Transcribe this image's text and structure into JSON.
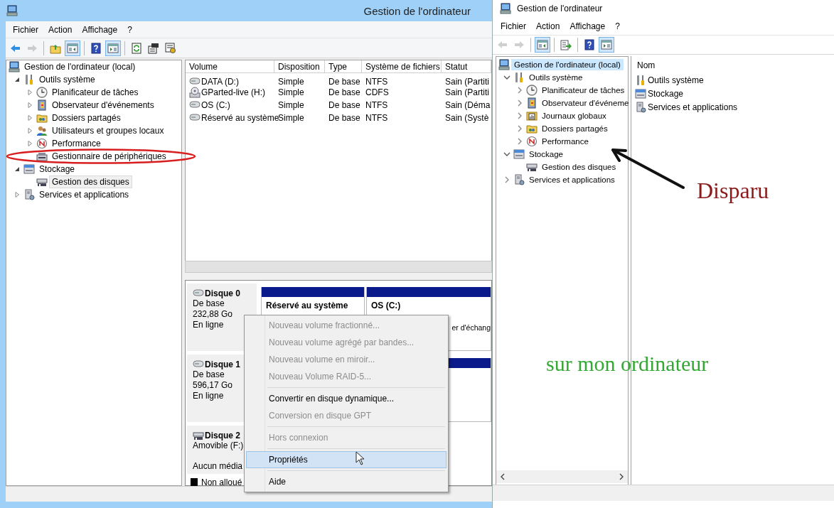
{
  "left_window": {
    "title": "Gestion de l'ordinateur",
    "menu": [
      "Fichier",
      "Action",
      "Affichage",
      "?"
    ],
    "toolbar": [
      {
        "kind": "button",
        "disabled": false,
        "pressed": false
      },
      {
        "kind": "button",
        "disabled": true,
        "pressed": false
      },
      {
        "kind": "separator"
      },
      {
        "kind": "button",
        "disabled": false,
        "pressed": false
      },
      {
        "kind": "button",
        "disabled": false,
        "pressed": true
      },
      {
        "kind": "separator"
      },
      {
        "kind": "button",
        "disabled": false,
        "pressed": false
      },
      {
        "kind": "button",
        "disabled": false,
        "pressed": true
      },
      {
        "kind": "separator"
      },
      {
        "kind": "button",
        "disabled": false,
        "pressed": false
      },
      {
        "kind": "button",
        "disabled": false,
        "pressed": false
      },
      {
        "kind": "button",
        "disabled": false,
        "pressed": false
      }
    ],
    "tree": [
      {
        "label": "Gestion de l'ordinateur (local)",
        "selected": false,
        "children": [
          {
            "label": "Outils système",
            "expanded": true,
            "selected": false,
            "children": [
              {
                "label": "Planificateur de tâches",
                "expanded": false,
                "selected": false
              },
              {
                "label": "Observateur d'événements",
                "expanded": false,
                "selected": false
              },
              {
                "label": "Dossiers partagés",
                "expanded": false,
                "selected": false
              },
              {
                "label": "Utilisateurs et groupes locaux",
                "expanded": false,
                "selected": false
              },
              {
                "label": "Performance",
                "expanded": false,
                "selected": false
              },
              {
                "label": "Gestionnaire de périphériques",
                "selected": false
              }
            ]
          },
          {
            "label": "Stockage",
            "expanded": true,
            "selected": false,
            "children": [
              {
                "label": "Gestion des disques",
                "selected": true
              }
            ]
          },
          {
            "label": "Services et applications",
            "expanded": false,
            "selected": false
          }
        ]
      }
    ],
    "volumes": {
      "columns": [
        "Volume",
        "Disposition",
        "Type",
        "Système de fichiers",
        "Statut"
      ],
      "rows": [
        [
          "DATA (D:)",
          "Simple",
          "De base",
          "NTFS",
          "Sain (Partiti"
        ],
        [
          "GParted-live (H:)",
          "Simple",
          "De base",
          "CDFS",
          "Sain (Partiti"
        ],
        [
          "OS (C:)",
          "Simple",
          "De base",
          "NTFS",
          "Sain (Déma"
        ],
        [
          "Réservé au système",
          "Simple",
          "De base",
          "NTFS",
          "Sain (Systè"
        ]
      ]
    },
    "disks": [
      {
        "name": "Disque 0",
        "lines": [
          "De base",
          "232,88 Go",
          "En ligne"
        ],
        "partitions": [
          {
            "kind": "primary",
            "name": "Réservé au système"
          },
          {
            "kind": "primary",
            "name": "OS  (C:)",
            "note": "er d'échang"
          }
        ]
      },
      {
        "name": "Disque 1",
        "lines": [
          "De base",
          "596,17 Go",
          "En ligne"
        ],
        "partitions": [
          {
            "kind": "primary"
          }
        ]
      },
      {
        "name": "Disque 2",
        "lines": [
          "Amovible (F:)"
        ],
        "media": "Aucun média"
      }
    ],
    "legend": [
      {
        "kind": "unallocated",
        "label": "Non alloué"
      }
    ],
    "context_menu": [
      {
        "kind": "item",
        "label": "Nouveau volume fractionné...",
        "disabled": true,
        "selected": false
      },
      {
        "kind": "item",
        "label": "Nouveau volume agrégé par bandes...",
        "disabled": true,
        "selected": false
      },
      {
        "kind": "item",
        "label": "Nouveau volume en miroir...",
        "disabled": true,
        "selected": false
      },
      {
        "kind": "item",
        "label": "Nouveau Volume RAID-5...",
        "disabled": true,
        "selected": false
      },
      {
        "kind": "separator"
      },
      {
        "kind": "item",
        "label": "Convertir en disque dynamique...",
        "disabled": false,
        "selected": false
      },
      {
        "kind": "item",
        "label": "Conversion en disque GPT",
        "disabled": true,
        "selected": false
      },
      {
        "kind": "separator"
      },
      {
        "kind": "item",
        "label": "Hors connexion",
        "disabled": true,
        "selected": false
      },
      {
        "kind": "separator"
      },
      {
        "kind": "item",
        "label": "Propriétés",
        "disabled": false,
        "selected": true
      },
      {
        "kind": "separator"
      },
      {
        "kind": "item",
        "label": "Aide",
        "disabled": false,
        "selected": false
      }
    ]
  },
  "right_window": {
    "title": "Gestion de l'ordinateur",
    "menu": [
      "Fichier",
      "Action",
      "Affichage",
      "?"
    ],
    "toolbar": [
      {
        "kind": "button",
        "disabled": true,
        "pressed": false
      },
      {
        "kind": "button",
        "disabled": true,
        "pressed": false
      },
      {
        "kind": "separator"
      },
      {
        "kind": "button",
        "disabled": false,
        "pressed": true
      },
      {
        "kind": "separator"
      },
      {
        "kind": "button",
        "disabled": false,
        "pressed": false
      },
      {
        "kind": "separator"
      },
      {
        "kind": "button",
        "disabled": false,
        "pressed": false
      },
      {
        "kind": "button",
        "disabled": false,
        "pressed": true
      }
    ],
    "tree": [
      {
        "label": "Gestion de l'ordinateur (local)",
        "selected": true,
        "children": [
          {
            "label": "Outils système",
            "expanded": true,
            "selected": false,
            "children": [
              {
                "label": "Planificateur de tâches",
                "expanded": false,
                "selected": false
              },
              {
                "label": "Observateur d'événeme",
                "expanded": false,
                "selected": false
              },
              {
                "label": "Journaux globaux",
                "expanded": false,
                "selected": false
              },
              {
                "label": "Dossiers partagés",
                "expanded": false,
                "selected": false
              },
              {
                "label": "Performance",
                "expanded": false,
                "selected": false
              }
            ]
          },
          {
            "label": "Stockage",
            "expanded": true,
            "selected": false,
            "children": [
              {
                "label": "Gestion des disques",
                "selected": false
              }
            ]
          },
          {
            "label": "Services et applications",
            "expanded": false,
            "selected": false
          }
        ]
      }
    ],
    "list": {
      "header": "Nom",
      "items": [
        "Outils système",
        "Stockage",
        "Services et applications"
      ]
    }
  },
  "annotations": [
    {
      "kind": "ellipse"
    },
    {
      "kind": "arrow"
    },
    {
      "kind": "text",
      "text": "Disparu",
      "color": "#8b1a1a"
    },
    {
      "kind": "text",
      "text": "sur mon ordinateur",
      "color": "#33a833"
    }
  ]
}
